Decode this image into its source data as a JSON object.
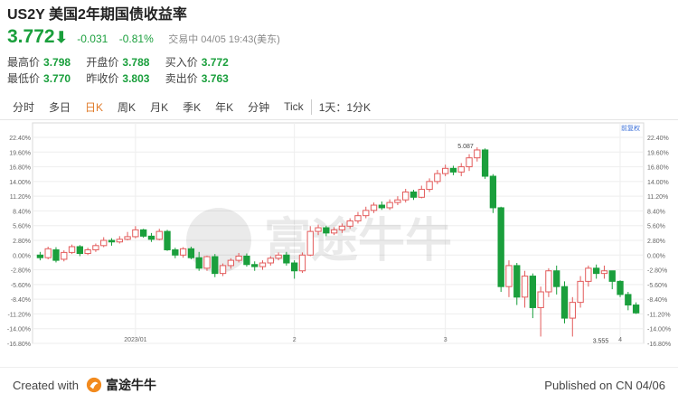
{
  "header": {
    "symbol": "US2Y",
    "name": "美国2年期国债收益率",
    "price": "3.772",
    "change": "-0.031",
    "change_pct": "-0.81%",
    "status": "交易中 04/05 19:43(美东)",
    "down_color": "#1a9f3c",
    "up_color": "#e35b5b"
  },
  "stats": {
    "high_label": "最高价",
    "high": "3.798",
    "open_label": "开盘价",
    "open": "3.788",
    "bid_label": "买入价",
    "bid": "3.772",
    "low_label": "最低价",
    "low": "3.770",
    "prev_label": "昨收价",
    "prev": "3.803",
    "ask_label": "卖出价",
    "ask": "3.763"
  },
  "tabs": [
    "分时",
    "多日",
    "日K",
    "周K",
    "月K",
    "季K",
    "年K",
    "分钟",
    "Tick"
  ],
  "active_tab": "日K",
  "interval": "1天：1分K",
  "adjust_label": "前复权",
  "watermark": "富途牛牛",
  "footer": {
    "created_with": "Created with",
    "brand": "富途牛牛",
    "published": "Published on CN 04/06"
  },
  "chart_data": {
    "type": "candlestick",
    "ylim": [
      -16.8,
      22.4
    ],
    "y_ticks": [
      "22.40%",
      "19.60%",
      "16.80%",
      "14.00%",
      "11.20%",
      "8.40%",
      "5.60%",
      "2.80%",
      "0.00%",
      "-2.80%",
      "-5.60%",
      "-8.40%",
      "-11.20%",
      "-14.00%",
      "-16.80%"
    ],
    "y_tick_values": [
      22.4,
      19.6,
      16.8,
      14.0,
      11.2,
      8.4,
      5.6,
      2.8,
      0,
      -2.8,
      -5.6,
      -8.4,
      -11.2,
      -14.0,
      -16.8
    ],
    "x_ticks": [
      {
        "label": "2023/01",
        "index": 12
      },
      {
        "label": "2",
        "index": 32
      },
      {
        "label": "3",
        "index": 51
      },
      {
        "label": "4",
        "index": 73
      }
    ],
    "annotations": [
      {
        "label": "5.087",
        "index": 55,
        "value": 20.0
      },
      {
        "label": "3.555",
        "index": 72,
        "value": -16.0
      }
    ],
    "candles": [
      [
        0.0,
        -0.5,
        0.6,
        -1.0
      ],
      [
        -0.5,
        1.2,
        1.6,
        -0.8
      ],
      [
        1.0,
        -1.0,
        1.5,
        -1.4
      ],
      [
        -0.8,
        0.5,
        0.9,
        -1.2
      ],
      [
        0.5,
        1.6,
        2.0,
        0.2
      ],
      [
        1.6,
        0.3,
        1.9,
        -0.2
      ],
      [
        0.3,
        1.0,
        1.4,
        0.0
      ],
      [
        1.0,
        1.8,
        2.2,
        0.6
      ],
      [
        1.8,
        2.8,
        3.4,
        1.5
      ],
      [
        2.8,
        2.5,
        3.2,
        1.8
      ],
      [
        2.5,
        3.0,
        3.6,
        2.2
      ],
      [
        3.0,
        3.5,
        4.4,
        2.8
      ],
      [
        3.5,
        4.8,
        5.5,
        3.2
      ],
      [
        4.8,
        3.6,
        5.0,
        3.3
      ],
      [
        3.6,
        3.0,
        4.2,
        2.5
      ],
      [
        3.0,
        4.5,
        5.0,
        2.8
      ],
      [
        4.5,
        1.0,
        4.8,
        0.8
      ],
      [
        1.0,
        0.0,
        1.4,
        -0.6
      ],
      [
        0.0,
        1.2,
        1.5,
        -0.5
      ],
      [
        1.2,
        -0.5,
        1.6,
        -0.8
      ],
      [
        -0.5,
        -2.5,
        0.6,
        -3.0
      ],
      [
        -2.5,
        -0.3,
        -0.1,
        -3.0
      ],
      [
        -0.3,
        -3.5,
        0.2,
        -4.2
      ],
      [
        -3.5,
        -2.0,
        -1.6,
        -4.0
      ],
      [
        -2.0,
        -1.0,
        -0.6,
        -2.6
      ],
      [
        -1.0,
        -0.2,
        0.4,
        -1.4
      ],
      [
        -0.2,
        -1.8,
        0.3,
        -2.2
      ],
      [
        -1.8,
        -2.2,
        -1.2,
        -3.0
      ],
      [
        -2.2,
        -1.5,
        -1.0,
        -2.8
      ],
      [
        -1.5,
        -0.6,
        -0.2,
        -2.0
      ],
      [
        -0.6,
        0.0,
        0.5,
        -1.0
      ],
      [
        0.0,
        -1.5,
        0.6,
        -2.0
      ],
      [
        -1.5,
        -3.0,
        -1.0,
        -4.5
      ],
      [
        -3.0,
        0.0,
        0.5,
        -3.4
      ],
      [
        0.0,
        4.5,
        5.5,
        -0.2
      ],
      [
        4.5,
        5.2,
        5.8,
        3.8
      ],
      [
        5.2,
        4.2,
        5.6,
        3.6
      ],
      [
        4.2,
        4.8,
        5.3,
        3.8
      ],
      [
        4.8,
        5.5,
        6.0,
        4.2
      ],
      [
        5.5,
        6.5,
        7.0,
        5.0
      ],
      [
        6.5,
        7.5,
        8.2,
        6.0
      ],
      [
        7.5,
        8.5,
        9.2,
        7.0
      ],
      [
        8.5,
        9.5,
        10.0,
        8.0
      ],
      [
        9.5,
        9.0,
        10.2,
        8.6
      ],
      [
        9.0,
        10.0,
        10.6,
        8.6
      ],
      [
        10.0,
        10.5,
        11.2,
        9.5
      ],
      [
        10.5,
        12.0,
        12.6,
        10.0
      ],
      [
        12.0,
        11.0,
        12.4,
        10.5
      ],
      [
        11.0,
        12.5,
        13.2,
        10.8
      ],
      [
        12.5,
        14.0,
        14.6,
        12.0
      ],
      [
        14.0,
        15.5,
        16.2,
        13.5
      ],
      [
        15.5,
        16.5,
        17.2,
        15.0
      ],
      [
        16.5,
        15.8,
        17.0,
        15.2
      ],
      [
        15.8,
        16.8,
        17.5,
        15.0
      ],
      [
        16.8,
        18.5,
        19.2,
        16.0
      ],
      [
        18.5,
        20.0,
        20.5,
        17.8
      ],
      [
        20.0,
        15.0,
        20.3,
        14.5
      ],
      [
        15.0,
        9.0,
        15.4,
        8.0
      ],
      [
        9.0,
        -6.0,
        9.2,
        -7.0
      ],
      [
        -6.0,
        -2.0,
        -1.0,
        -8.0
      ],
      [
        -2.0,
        -8.0,
        -1.5,
        -9.5
      ],
      [
        -8.0,
        -4.0,
        -3.0,
        -10.0
      ],
      [
        -4.0,
        -10.0,
        -3.5,
        -12.0
      ],
      [
        -10.0,
        -7.0,
        -6.0,
        -15.5
      ],
      [
        -7.0,
        -3.0,
        -2.5,
        -8.0
      ],
      [
        -3.0,
        -6.0,
        -2.0,
        -7.5
      ],
      [
        -6.0,
        -12.0,
        -5.0,
        -13.0
      ],
      [
        -12.0,
        -9.0,
        -8.0,
        -15.5
      ],
      [
        -9.0,
        -5.0,
        -4.0,
        -10.0
      ],
      [
        -5.0,
        -2.5,
        -2.0,
        -6.0
      ],
      [
        -2.5,
        -3.5,
        -1.8,
        -4.5
      ],
      [
        -3.5,
        -3.0,
        -2.0,
        -4.5
      ],
      [
        -3.0,
        -5.0,
        -4.0,
        -6.5
      ],
      [
        -5.0,
        -7.5,
        -4.8,
        -8.0
      ],
      [
        -7.5,
        -9.5,
        -7.0,
        -10.5
      ],
      [
        -9.5,
        -11.0,
        -9.0,
        -11.2
      ]
    ]
  }
}
